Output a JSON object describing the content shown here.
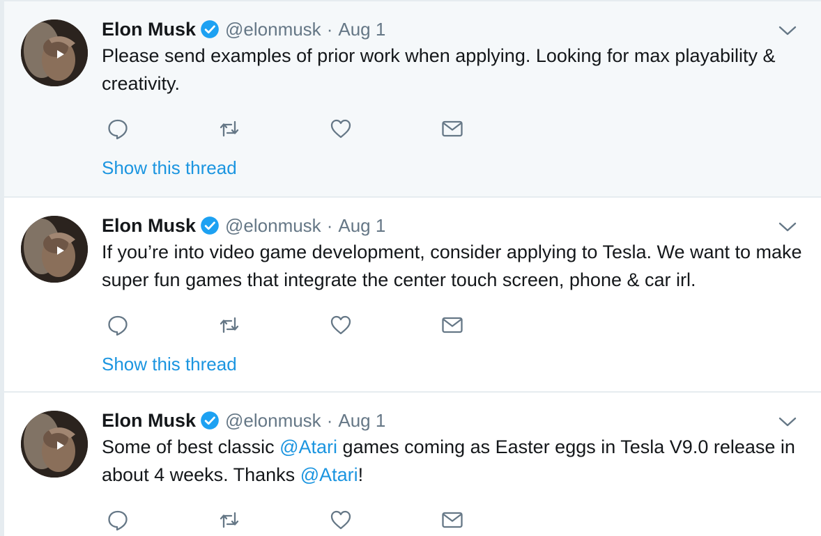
{
  "tweets": [
    {
      "author_name": "Elon Musk",
      "handle": "@elonmusk",
      "separator": "·",
      "date": "Aug 1",
      "text_parts": [
        {
          "text": "Please send examples of prior work when applying. Looking for max playability & creativity.",
          "type": "text"
        }
      ],
      "show_thread": "Show this thread"
    },
    {
      "author_name": "Elon Musk",
      "handle": "@elonmusk",
      "separator": "·",
      "date": "Aug 1",
      "text_parts": [
        {
          "text": "If you’re into video game development, consider applying to Tesla. We want to make super fun games that integrate the center touch screen, phone & car irl.",
          "type": "text"
        }
      ],
      "show_thread": "Show this thread"
    },
    {
      "author_name": "Elon Musk",
      "handle": "@elonmusk",
      "separator": "·",
      "date": "Aug 1",
      "text_parts": [
        {
          "text": "Some of best classic ",
          "type": "text"
        },
        {
          "text": "@Atari",
          "type": "mention"
        },
        {
          "text": " games coming as Easter eggs in Tesla V9.0 release in about 4 weeks. Thanks ",
          "type": "text"
        },
        {
          "text": "@Atari",
          "type": "mention"
        },
        {
          "text": "!",
          "type": "text"
        }
      ]
    }
  ],
  "icons": {
    "verified": "verified-badge-icon",
    "caret": "chevron-down-icon",
    "reply": "reply-icon",
    "retweet": "retweet-icon",
    "like": "heart-icon",
    "dm": "envelope-icon"
  },
  "colors": {
    "link": "#1b95e0",
    "secondary_text": "#657786",
    "highlight_bg": "#f5f8fa",
    "verified": "#1da1f2"
  }
}
